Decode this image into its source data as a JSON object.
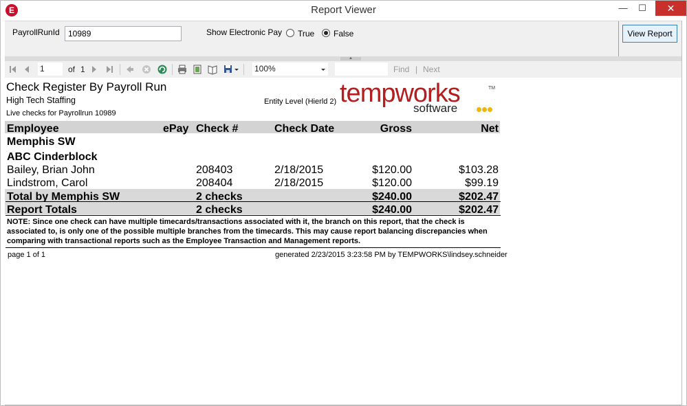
{
  "window": {
    "title": "Report Viewer",
    "logo_letter": "E",
    "min_glyph": "—",
    "max_glyph": "☐",
    "close_glyph": "✕"
  },
  "params": {
    "run_label": "PayrollRunId",
    "run_value": "10989",
    "epay_label": "Show Electronic Pay",
    "true_label": "True",
    "false_label": "False",
    "selected": "False",
    "view_button": "View Report"
  },
  "toolbar": {
    "page_value": "1",
    "of_label": "of",
    "total_pages": "1",
    "zoom": "100%",
    "find_label": "Find",
    "next_label": "Next",
    "divider": "|"
  },
  "report": {
    "title": "Check Register By Payroll Run",
    "company": "High Tech Staffing",
    "entity_level": "Entity Level (Hierld 2)",
    "live_checks": "Live checks for Payrollrun 10989",
    "logo_main": "tempworks",
    "logo_sub": "software",
    "logo_tm": "TM",
    "columns": [
      "Employee",
      "ePay",
      "Check #",
      "Check Date",
      "Gross",
      "Net"
    ],
    "branch": "Memphis SW",
    "customer": "ABC Cinderblock",
    "rows": [
      {
        "employee": "Bailey, Brian John",
        "epay": "",
        "check": "208403",
        "date": "2/18/2015",
        "gross": "$120.00",
        "net": "$103.28"
      },
      {
        "employee": "Lindstrom, Carol",
        "epay": "",
        "check": "208404",
        "date": "2/18/2015",
        "gross": "$120.00",
        "net": "$99.19"
      }
    ],
    "branch_total": {
      "label": "Total by Memphis SW",
      "checks": "2 checks",
      "gross": "$240.00",
      "net": "$202.47"
    },
    "report_total": {
      "label": "Report Totals",
      "checks": "2 checks",
      "gross": "$240.00",
      "net": "$202.47"
    },
    "note": "NOTE: Since one check can have multiple timecards/transactions associated with it, the branch on this report, that the check is associated to, is only one of the possible multiple branches from the timecards.  This may cause report balancing discrepancies when comparing with transactional reports such as the Employee Transaction and  Management reports.",
    "page_footer": "page 1 of 1",
    "generated": "generated 2/23/2015 3:23:58 PM by TEMPWORKS\\lindsey.schneider"
  },
  "colors": {
    "close_red": "#c7302b",
    "logo_red": "#b41e1e",
    "logo_dots": "#f2b705",
    "header_gray": "#d3d3d3"
  }
}
